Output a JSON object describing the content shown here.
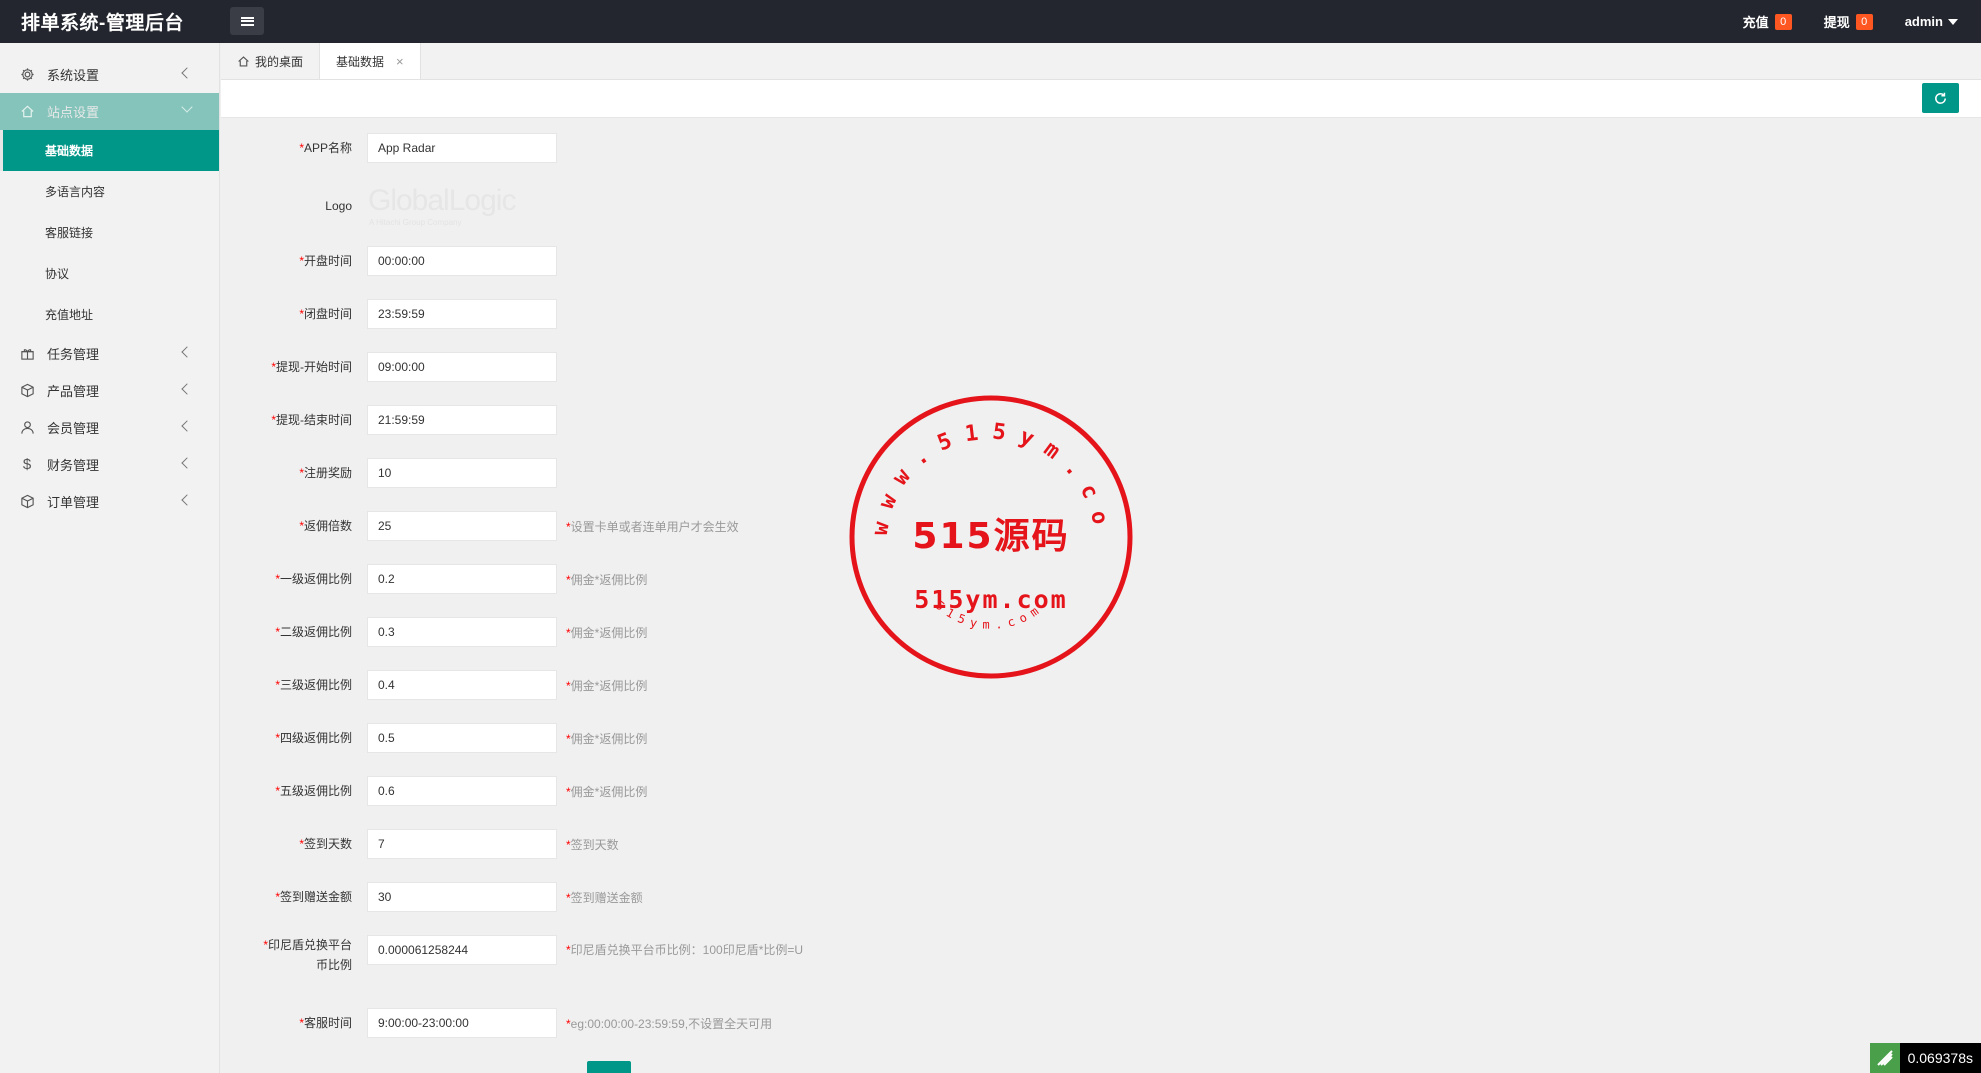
{
  "header": {
    "title": "排单系统-管理后台",
    "recharge_label": "充值",
    "recharge_count": "0",
    "withdraw_label": "提现",
    "withdraw_count": "0",
    "user": "admin"
  },
  "sidebar": {
    "groups": [
      {
        "label": "系统设置",
        "icon": "gear-icon"
      },
      {
        "label": "站点设置",
        "icon": "home-icon"
      },
      {
        "label": "任务管理",
        "icon": "gift-icon"
      },
      {
        "label": "产品管理",
        "icon": "box-icon"
      },
      {
        "label": "会员管理",
        "icon": "user-icon"
      },
      {
        "label": "财务管理",
        "icon": "dollar-icon"
      },
      {
        "label": "订单管理",
        "icon": "box-icon"
      }
    ],
    "sub_items": [
      "基础数据",
      "多语言内容",
      "客服链接",
      "协议",
      "充值地址"
    ]
  },
  "tabs": [
    {
      "label": "我的桌面",
      "icon": "home-icon"
    },
    {
      "label": "基础数据",
      "close": "×"
    }
  ],
  "form": {
    "app_name": {
      "label": "APP名称",
      "value": "App Radar"
    },
    "logo": {
      "label": "Logo",
      "text": "GlobalLogic",
      "sub": "A Hitachi Group Company"
    },
    "open_time": {
      "label": "开盘时间",
      "value": "00:00:00"
    },
    "close_time": {
      "label": "闭盘时间",
      "value": "23:59:59"
    },
    "withdraw_start": {
      "label": "提现-开始时间",
      "value": "09:00:00"
    },
    "withdraw_end": {
      "label": "提现-结束时间",
      "value": "21:59:59"
    },
    "register_reward": {
      "label": "注册奖励",
      "value": "10"
    },
    "rebate_multiple": {
      "label": "返佣倍数",
      "value": "25",
      "hint": "设置卡单或者连单用户才会生效"
    },
    "level1": {
      "label": "一级返佣比例",
      "value": "0.2",
      "hint": "佣金*返佣比例"
    },
    "level2": {
      "label": "二级返佣比例",
      "value": "0.3",
      "hint": "佣金*返佣比例"
    },
    "level3": {
      "label": "三级返佣比例",
      "value": "0.4",
      "hint": "佣金*返佣比例"
    },
    "level4": {
      "label": "四级返佣比例",
      "value": "0.5",
      "hint": "佣金*返佣比例"
    },
    "level5": {
      "label": "五级返佣比例",
      "value": "0.6",
      "hint": "佣金*返佣比例"
    },
    "signin_days": {
      "label": "签到天数",
      "value": "7",
      "hint": "签到天数"
    },
    "signin_amount": {
      "label": "签到赠送金额",
      "value": "30",
      "hint": "签到赠送金额"
    },
    "exchange_rate": {
      "label_line1": "印尼盾兑换平台",
      "label_line2": "币比例",
      "value": "0.000061258244",
      "hint": "印尼盾兑换平台币比例：100印尼盾*比例=U"
    },
    "service_time": {
      "label": "客服时间",
      "value": "9:00:00-23:00:00",
      "hint": "eg:00:00:00-23:59:59,不设置全天可用"
    },
    "required_mark": "*"
  },
  "watermark": {
    "arc_top": "www.515ym.com",
    "center": "515源码",
    "domain": "515ym.com",
    "arc_bottom": "515ym.com"
  },
  "timer": "0.069378s",
  "colors": {
    "primary": "#009688",
    "badge": "#ff5722",
    "topbar": "#23262e",
    "stamp": "#e5141a"
  }
}
